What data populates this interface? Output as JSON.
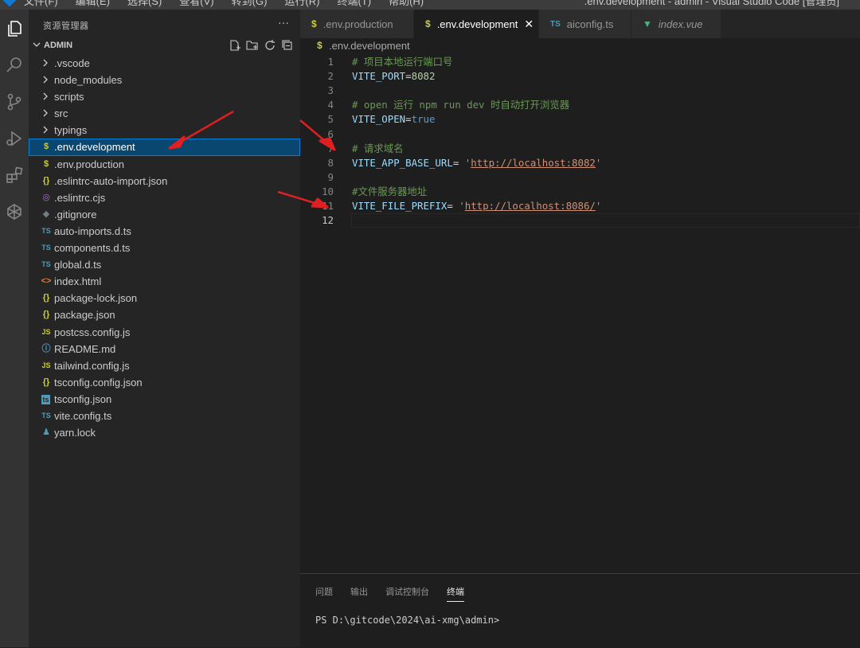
{
  "titlebar": {
    "menu": [
      "文件(F)",
      "编辑(E)",
      "选择(S)",
      "查看(V)",
      "转到(G)",
      "运行(R)",
      "终端(T)",
      "帮助(H)"
    ],
    "window_title": ".env.development - admin - Visual Studio Code [管理员]"
  },
  "activity_bar": {
    "icons": [
      "explorer-icon",
      "search-icon",
      "source-control-icon",
      "run-debug-icon",
      "extensions-icon",
      "remote-icon"
    ]
  },
  "sidebar": {
    "header": "资源管理器",
    "more": "···",
    "folder": "ADMIN",
    "folder_actions": [
      "new-file-icon",
      "new-folder-icon",
      "refresh-icon",
      "collapse-icon"
    ],
    "items": [
      {
        "label": ".vscode",
        "type": "folder"
      },
      {
        "label": "node_modules",
        "type": "folder"
      },
      {
        "label": "scripts",
        "type": "folder"
      },
      {
        "label": "src",
        "type": "folder"
      },
      {
        "label": "typings",
        "type": "folder"
      },
      {
        "label": ".env.development",
        "type": "env",
        "icon": "$",
        "color": "#cbcb41",
        "selected": true
      },
      {
        "label": ".env.production",
        "type": "env",
        "icon": "$",
        "color": "#cbcb41"
      },
      {
        "label": ".eslintrc-auto-import.json",
        "type": "json",
        "icon": "{}",
        "color": "#cbcb41"
      },
      {
        "label": ".eslintrc.cjs",
        "type": "eslint",
        "icon": "◎",
        "color": "#a074c4"
      },
      {
        "label": ".gitignore",
        "type": "git",
        "icon": "◆",
        "color": "#6d8086"
      },
      {
        "label": "auto-imports.d.ts",
        "type": "ts",
        "icon": "TS",
        "color": "#519aba"
      },
      {
        "label": "components.d.ts",
        "type": "ts",
        "icon": "TS",
        "color": "#519aba"
      },
      {
        "label": "global.d.ts",
        "type": "ts",
        "icon": "TS",
        "color": "#519aba"
      },
      {
        "label": "index.html",
        "type": "html",
        "icon": "<>",
        "color": "#e37933"
      },
      {
        "label": "package-lock.json",
        "type": "json",
        "icon": "{}",
        "color": "#cbcb41"
      },
      {
        "label": "package.json",
        "type": "json",
        "icon": "{}",
        "color": "#cbcb41"
      },
      {
        "label": "postcss.config.js",
        "type": "js",
        "icon": "JS",
        "color": "#cbcb41"
      },
      {
        "label": "README.md",
        "type": "md",
        "icon": "ⓘ",
        "color": "#519aba"
      },
      {
        "label": "tailwind.config.js",
        "type": "js",
        "icon": "JS",
        "color": "#cbcb41"
      },
      {
        "label": "tsconfig.config.json",
        "type": "json",
        "icon": "{}",
        "color": "#cbcb41"
      },
      {
        "label": "tsconfig.json",
        "type": "tsconfig",
        "icon": "ts",
        "color": "#519aba"
      },
      {
        "label": "vite.config.ts",
        "type": "ts",
        "icon": "TS",
        "color": "#519aba"
      },
      {
        "label": "yarn.lock",
        "type": "yarn",
        "icon": "♟",
        "color": "#519aba"
      }
    ]
  },
  "tabs": [
    {
      "label": ".env.production",
      "icon": "$",
      "color": "#cbcb41",
      "active": false
    },
    {
      "label": ".env.development",
      "icon": "$",
      "color": "#cbcb41",
      "active": true,
      "close": "✕"
    },
    {
      "label": "aiconfig.ts",
      "icon": "TS",
      "color": "#519aba",
      "active": false
    },
    {
      "label": "index.vue",
      "icon": "▼",
      "color": "#41b883",
      "active": false,
      "italic": true
    }
  ],
  "breadcrumb": {
    "icon": "$",
    "label": ".env.development"
  },
  "editor": {
    "current_line": 12,
    "lines": [
      {
        "n": "1",
        "comment": "# 项目本地运行端口号"
      },
      {
        "n": "2",
        "key": "VITE_PORT",
        "eq": "=",
        "num": "8082"
      },
      {
        "n": "3"
      },
      {
        "n": "4",
        "comment": "# open 运行 npm run dev 时自动打开浏览器"
      },
      {
        "n": "5",
        "key": "VITE_OPEN",
        "eq": "=",
        "bool": "true"
      },
      {
        "n": "6"
      },
      {
        "n": "7",
        "comment": "# 请求域名"
      },
      {
        "n": "8",
        "key": "VITE_APP_BASE_URL",
        "eq": "= ",
        "q1": "'",
        "url": "http://localhost:8082",
        "q2": "'"
      },
      {
        "n": "9"
      },
      {
        "n": "10",
        "comment": "#文件服务器地址"
      },
      {
        "n": "11",
        "key": "VITE_FILE_PREFIX",
        "eq": "= ",
        "q1": "'",
        "url": "http://localhost:8086/",
        "q2": "'"
      },
      {
        "n": "12"
      }
    ]
  },
  "panel": {
    "tabs": [
      {
        "label": "问题",
        "active": false
      },
      {
        "label": "输出",
        "active": false
      },
      {
        "label": "调试控制台",
        "active": false
      },
      {
        "label": "终端",
        "active": true
      }
    ],
    "terminal_prompt": "PS D:\\gitcode\\2024\\ai-xmg\\admin>"
  },
  "colors": {
    "annotation_arrow": "#e02020",
    "selection": "#094771",
    "focus_border": "#007fd4"
  }
}
